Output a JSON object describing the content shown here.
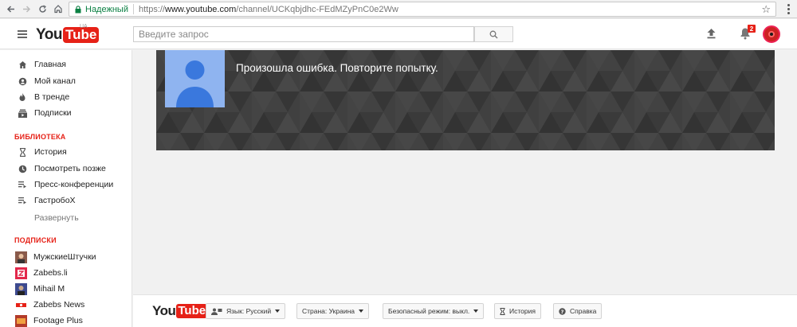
{
  "browser": {
    "secure_label": "Надежный",
    "url_scheme": "https://",
    "url_host": "www.youtube.com",
    "url_path": "/channel/UCKqbjdhc-FEdMZyPnC0e2Ww"
  },
  "header": {
    "logo_you": "You",
    "logo_tube": "Tube",
    "logo_region": "UA",
    "search_placeholder": "Введите запрос",
    "notification_count": "2"
  },
  "sidebar": {
    "main_items": [
      {
        "label": "Главная",
        "icon": "home-icon"
      },
      {
        "label": "Мой канал",
        "icon": "person-icon"
      },
      {
        "label": "В тренде",
        "icon": "flame-icon"
      },
      {
        "label": "Подписки",
        "icon": "subscriptions-icon"
      }
    ],
    "library_title": "БИБЛИОТЕКА",
    "library_items": [
      {
        "label": "История",
        "icon": "hourglass-icon"
      },
      {
        "label": "Посмотреть позже",
        "icon": "clock-icon"
      },
      {
        "label": "Пресс-конференции",
        "icon": "playlist-icon"
      },
      {
        "label": "ГастробоХ",
        "icon": "playlist-icon"
      }
    ],
    "expand_label": "Развернуть",
    "subscriptions_title": "ПОДПИСКИ",
    "subscriptions": [
      {
        "label": "МужскиеШтучки",
        "color": "#8a5a4a"
      },
      {
        "label": "Zabebs.li",
        "color": "#e2284b"
      },
      {
        "label": "Mihail M",
        "color": "#3d4a8f"
      },
      {
        "label": "Zabebs News",
        "color": "#e62117"
      },
      {
        "label": "Footage Plus",
        "color": "#b33b2a"
      }
    ]
  },
  "banner": {
    "error_message": "Произошла ошибка. Повторите попытку."
  },
  "footer": {
    "logo_you": "You",
    "logo_tube": "Tube",
    "language": "Язык: Русский",
    "country": "Страна: Украина",
    "safe_mode": "Безопасный режим: выкл.",
    "history": "История",
    "help": "Справка"
  },
  "colors": {
    "accent": "#e62117",
    "secure_green": "#0b8043",
    "banner_bg": "#3d3d3d",
    "profile_bg": "#8fb4f0",
    "profile_figure": "#3a78dd"
  }
}
